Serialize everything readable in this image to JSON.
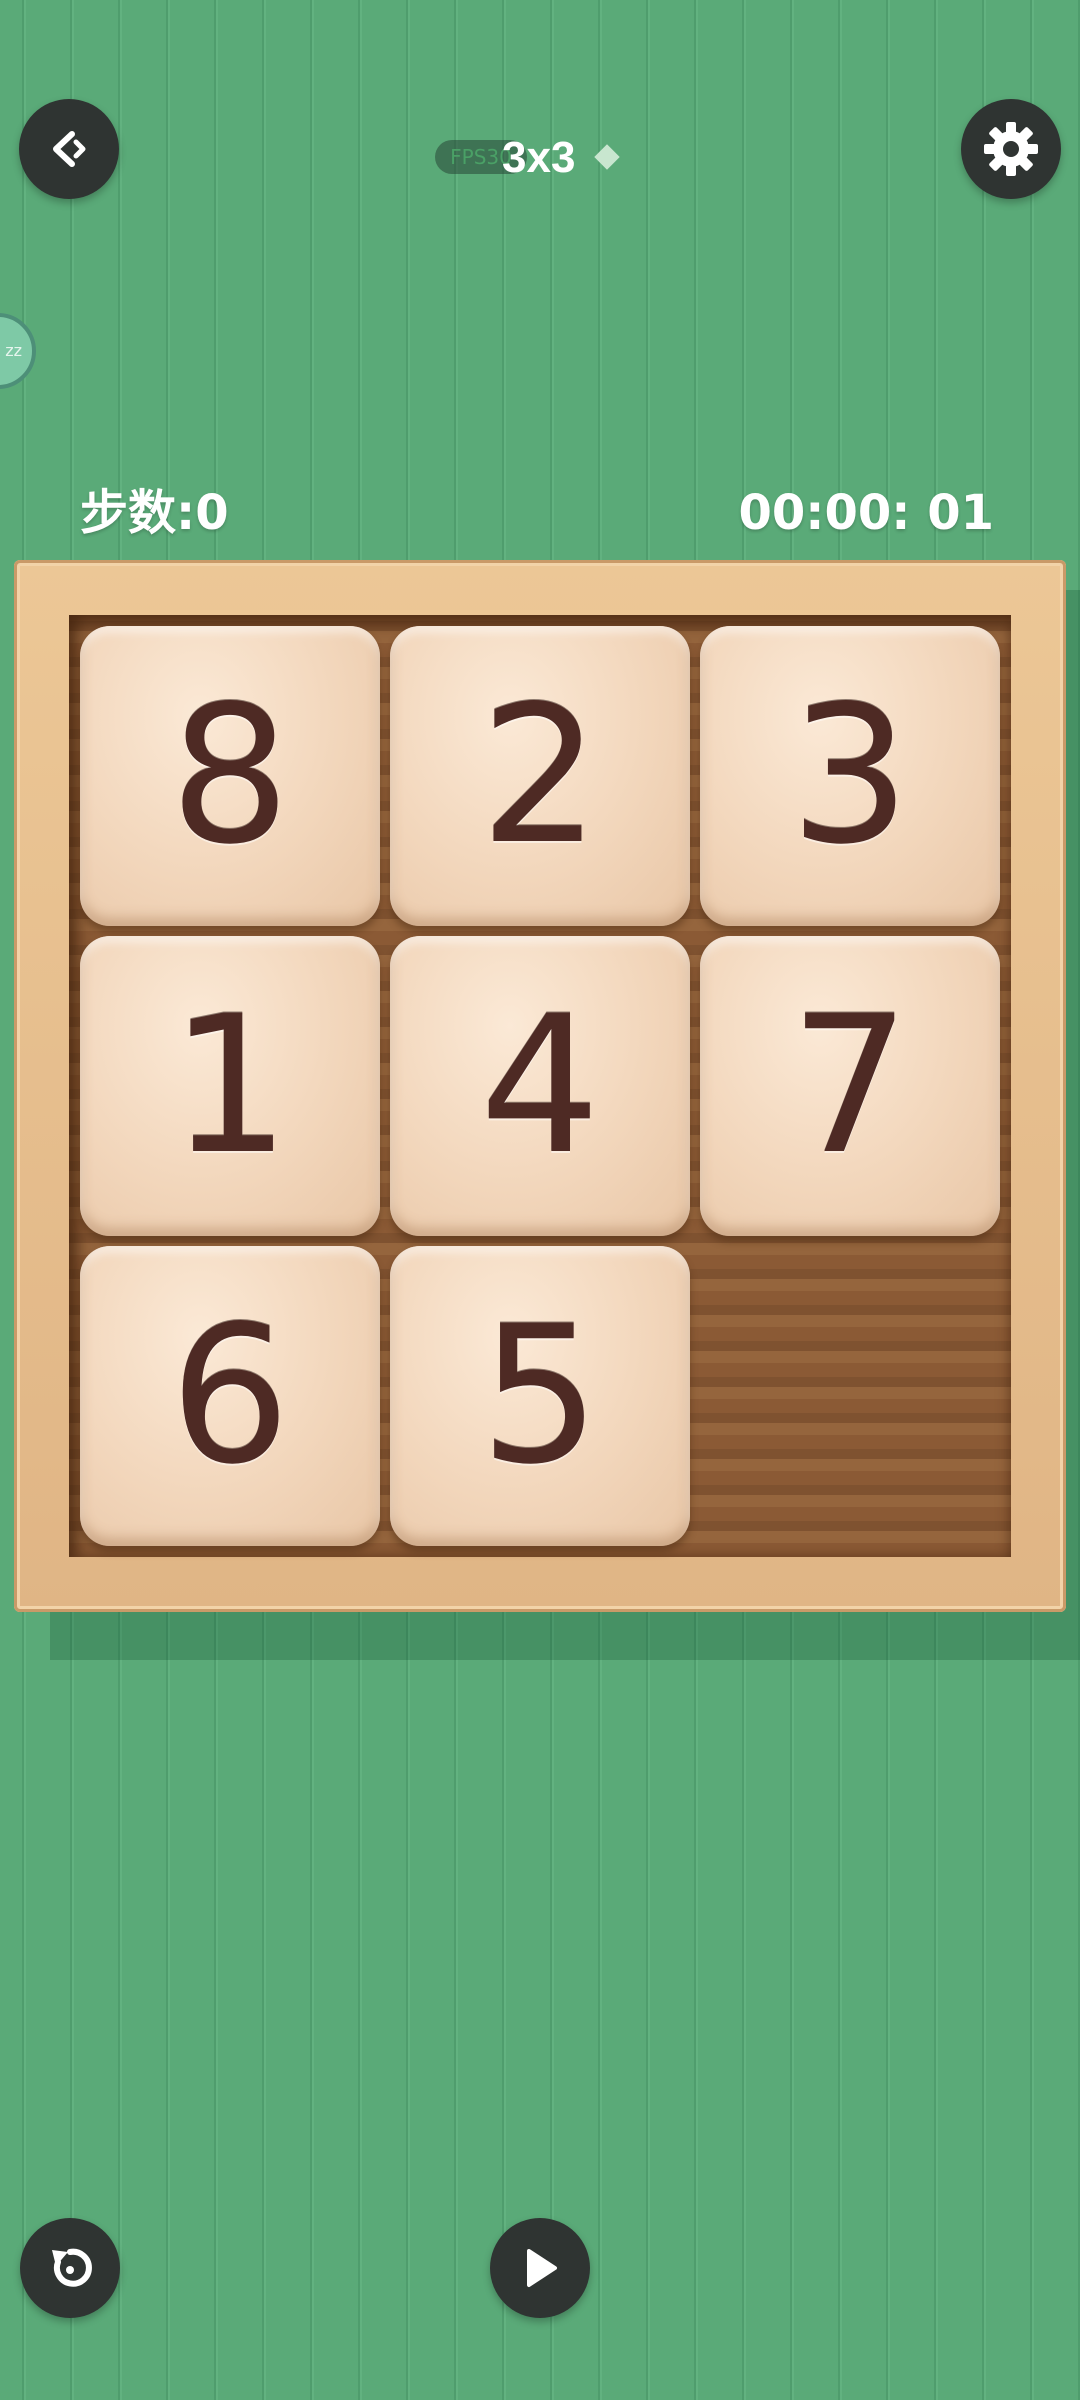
{
  "header": {
    "fps_label": "FPS30",
    "puzzle_size": "3x3"
  },
  "side_bubble": {
    "text": "zz"
  },
  "stats": {
    "moves": "步数:0",
    "timer": "00:00: 01"
  },
  "board": {
    "rows": 3,
    "cols": 3,
    "tiles": [
      "8",
      "2",
      "3",
      "1",
      "4",
      "7",
      "6",
      "5"
    ],
    "empty_slot": "row 3, column 3"
  },
  "icons": {
    "back": "back-arrow-icon",
    "settings": "gear-icon",
    "restart": "restart-icon",
    "play": "play-icon"
  },
  "colors": {
    "background": "#5aaa78",
    "button_bg": "#2f3432",
    "tile_text": "#4e2a24",
    "frame": "#ecc796"
  }
}
